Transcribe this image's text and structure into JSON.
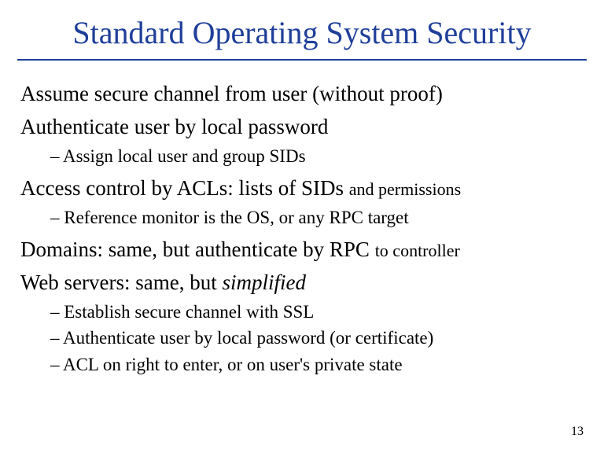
{
  "title": "Standard Operating System Security",
  "blocks": [
    {
      "main": "Assume secure channel from user (without proof)",
      "subs": []
    },
    {
      "main": "Authenticate user by local password",
      "subs": [
        "Assign local user and group SIDs"
      ]
    },
    {
      "main_prefix": "Access control by ACLs: lists of SIDs ",
      "main_tail": "and permissions",
      "subs": [
        "Reference monitor is the OS, or any RPC target"
      ]
    },
    {
      "main_prefix": "Domains: same, but authenticate by RPC ",
      "main_tail": "to controller",
      "subs": []
    },
    {
      "main_prefix": "Web servers: same, but ",
      "main_italic": "simplified",
      "subs": [
        "Establish secure channel with SSL",
        "Authenticate user by local password (or certificate)",
        "ACL on right to enter, or on user's private state"
      ]
    }
  ],
  "page_number": "13"
}
